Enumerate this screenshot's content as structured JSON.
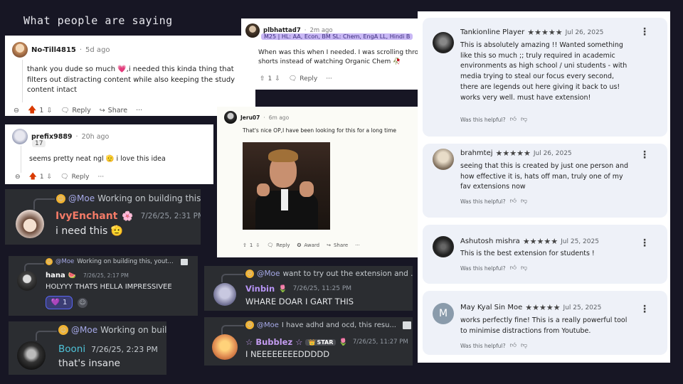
{
  "heading": "What people are saying",
  "reddit": {
    "post1": {
      "user": "No-Till4815",
      "time": "5d ago",
      "text": "thank you dude so much 💗,i needed this kinda thing that filters out distracting content while also keeping the study content intact",
      "votes": "1",
      "reply": "Reply",
      "share": "Share",
      "more": "···"
    },
    "post2": {
      "user": "prefix9889",
      "time": "20h ago",
      "badge": "17",
      "text": "seems pretty neat ngl 🫡 i love this idea",
      "votes": "1",
      "reply": "Reply",
      "more": "···"
    },
    "post3": {
      "user": "plbhattad7",
      "time": "2m ago",
      "flair": "M25 | HL: AA, Econ, BM SL: Chem, EngA LL, Hindi B",
      "text": "When was this when I needed. I was scrolling through YT shorts instead of watching Organic Chem 🥀",
      "votes": "1",
      "reply": "Reply",
      "more": "···"
    },
    "post4": {
      "user": "Jeru07",
      "time": "6m ago",
      "text": "That's nice OP,I have been looking for this for a long time",
      "votes": "1",
      "reply": "Reply",
      "award": "Award",
      "share": "Share",
      "more": "···"
    }
  },
  "discord": {
    "msg1": {
      "reply_user": "@Moe",
      "reply_text": "Working on building this",
      "name": "IvyEnchant",
      "emoji": "🌸",
      "time": "7/26/25, 2:31 PM",
      "text": "i need this 🫡",
      "name_color": "#f47b67"
    },
    "msg2": {
      "reply_user": "@Moe",
      "reply_text": "Working on building this, yout...",
      "name": "hana",
      "emoji": "🍉",
      "time": "7/26/25, 2:17 PM",
      "text": "HOLYYY THATS HELLA IMPRESSIVEE",
      "reaction_count": "1",
      "reaction": "💜",
      "name_color": "#ffffff"
    },
    "msg3": {
      "reply_user": "@Moe",
      "reply_text": "Working on buil",
      "name": "Booni",
      "time": "7/26/25, 2:23 PM",
      "text": "that's insane",
      "name_color": "#4fc3d9"
    },
    "msg4": {
      "reply_user": "@Moe",
      "reply_text": "want to try out the extension and ...",
      "name": "Vinbin",
      "emoji": "🌷",
      "time": "7/26/25, 11:25 PM",
      "text": "WHARE DOAR I GART THIS",
      "name_color": "#b794f6"
    },
    "msg5": {
      "reply_user": "@Moe",
      "reply_text": "I have adhd and ocd, this resu...",
      "name": "☆ Bubblez ☆",
      "star_tag": "STAR",
      "emoji": "🌷",
      "time": "7/26/25, 11:27 PM",
      "text": "I NEEEEEEEEDDDDD",
      "name_color": "#f0c14b"
    }
  },
  "store": {
    "helpful_label": "Was this helpful?",
    "reviews": [
      {
        "name": "Tankionline Player",
        "stars": "★★★★★",
        "date": "Jul 26, 2025",
        "text": "This is absolutely amazing !! Wanted something like this so much ;; truly required in academic environments as high school / uni students - with media trying to steal our focus every second, there are legends out here giving it back to us! works very well. must have extension!"
      },
      {
        "name": "brahmtej",
        "stars": "★★★★★",
        "date": "Jul 26, 2025",
        "text": "seeing that this is created by just one person and how effective it is, hats off man, truly one of my fav extensions now"
      },
      {
        "name": "Ashutosh mishra",
        "stars": "★★★★★",
        "date": "Jul 25, 2025",
        "text": "This is the best extension for students !"
      },
      {
        "name": "May Kyal Sin Moe",
        "stars": "★★★★★",
        "date": "Jul 25, 2025",
        "text": "works perfectly fine! This is a really powerful tool to minimise distractions from Youtube.",
        "initial": "M"
      }
    ]
  }
}
